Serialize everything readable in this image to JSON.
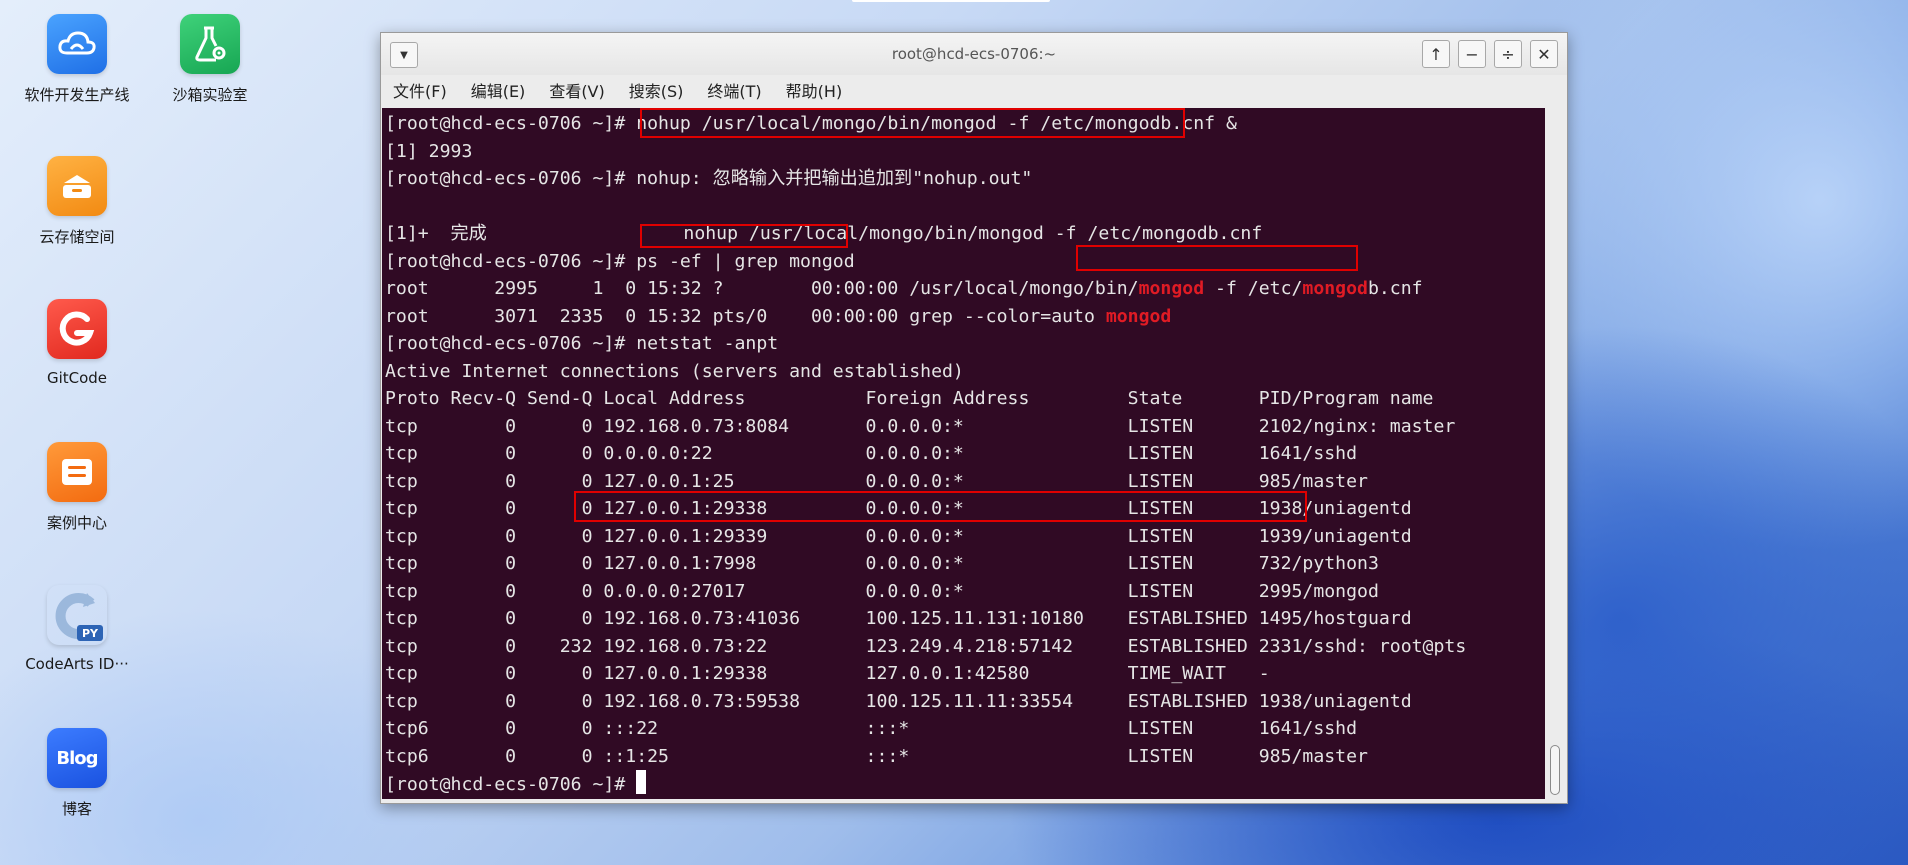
{
  "desktop": {
    "icons": [
      {
        "label": "软件开发生产线",
        "glyph": "cloud-icon"
      },
      {
        "label": "沙箱实验室",
        "glyph": "flask-gear-icon"
      },
      {
        "label": "云存储空间",
        "glyph": "storage-icon"
      },
      {
        "label": "GitCode",
        "glyph": "gitcode-logo-icon"
      },
      {
        "label": "案例中心",
        "glyph": "case-list-icon"
      },
      {
        "label": "CodeArts ID···",
        "glyph": "codearts-python-icon"
      },
      {
        "label": "博客",
        "glyph": "blog-icon",
        "tile_text": "Blog"
      }
    ]
  },
  "window": {
    "title": "root@hcd-ecs-0706:~",
    "buttons": {
      "up": "↑",
      "minimize": "−",
      "resize": "÷",
      "close": "✕"
    },
    "menu": [
      "文件(F)",
      "编辑(E)",
      "查看(V)",
      "搜索(S)",
      "终端(T)",
      "帮助(H)"
    ]
  },
  "terminal": {
    "colors": {
      "background": "#300a24",
      "text": "#e5e5e5",
      "highlight": "#e01b24",
      "annotation_box": "#e00000"
    },
    "lines": [
      [
        {
          "t": "[root@hcd-ecs-0706 ~]# nohup /usr/local/mongo/bin/mongod -f /etc/mongodb.cnf &"
        }
      ],
      [
        {
          "t": "[1] 2993"
        }
      ],
      [
        {
          "t": "[root@hcd-ecs-0706 ~]# nohup: 忽略输入并把输出追加到\"nohup.out\""
        }
      ],
      [
        {
          "t": ""
        }
      ],
      [
        {
          "t": "[1]+  完成                  nohup /usr/local/mongo/bin/mongod -f /etc/mongodb.cnf"
        }
      ],
      [
        {
          "t": "[root@hcd-ecs-0706 ~]# ps -ef | grep mongod"
        }
      ],
      [
        {
          "t": "root      2995     1  0 15:32 ?        00:00:00 /usr/local/mongo/bin/"
        },
        {
          "t": "mongod",
          "hl": true
        },
        {
          "t": " -f /etc/"
        },
        {
          "t": "mongod",
          "hl": true
        },
        {
          "t": "b.cnf"
        }
      ],
      [
        {
          "t": "root      3071  2335  0 15:32 pts/0    00:00:00 grep --color=auto "
        },
        {
          "t": "mongod",
          "hl": true
        }
      ],
      [
        {
          "t": "[root@hcd-ecs-0706 ~]# netstat -anpt"
        }
      ],
      [
        {
          "t": "Active Internet connections (servers and established)"
        }
      ],
      [
        {
          "t": "Proto Recv-Q Send-Q Local Address           Foreign Address         State       PID/Program name"
        }
      ],
      [
        {
          "t": "tcp        0      0 192.168.0.73:8084       0.0.0.0:*               LISTEN      2102/nginx: master"
        }
      ],
      [
        {
          "t": "tcp        0      0 0.0.0.0:22              0.0.0.0:*               LISTEN      1641/sshd"
        }
      ],
      [
        {
          "t": "tcp        0      0 127.0.0.1:25            0.0.0.0:*               LISTEN      985/master"
        }
      ],
      [
        {
          "t": "tcp        0      0 127.0.0.1:29338         0.0.0.0:*               LISTEN      1938/uniagentd"
        }
      ],
      [
        {
          "t": "tcp        0      0 127.0.0.1:29339         0.0.0.0:*               LISTEN      1939/uniagentd"
        }
      ],
      [
        {
          "t": "tcp        0      0 127.0.0.1:7998          0.0.0.0:*               LISTEN      732/python3"
        }
      ],
      [
        {
          "t": "tcp        0      0 0.0.0.0:27017           0.0.0.0:*               LISTEN      2995/mongod"
        }
      ],
      [
        {
          "t": "tcp        0      0 192.168.0.73:41036      100.125.11.131:10180    ESTABLISHED 1495/hostguard"
        }
      ],
      [
        {
          "t": "tcp        0    232 192.168.0.73:22         123.249.4.218:57142     ESTABLISHED 2331/sshd: root@pts"
        }
      ],
      [
        {
          "t": "tcp        0      0 127.0.0.1:29338         127.0.0.1:42580         TIME_WAIT   -"
        }
      ],
      [
        {
          "t": "tcp        0      0 192.168.0.73:59538      100.125.11.11:33554     ESTABLISHED 1938/uniagentd"
        }
      ],
      [
        {
          "t": "tcp6       0      0 :::22                   :::*                    LISTEN      1641/sshd"
        }
      ],
      [
        {
          "t": "tcp6       0      0 ::1:25                  :::*                    LISTEN      985/master"
        }
      ],
      [
        {
          "t": "[root@hcd-ecs-0706 ~]# "
        },
        {
          "cursor": true
        }
      ]
    ]
  }
}
